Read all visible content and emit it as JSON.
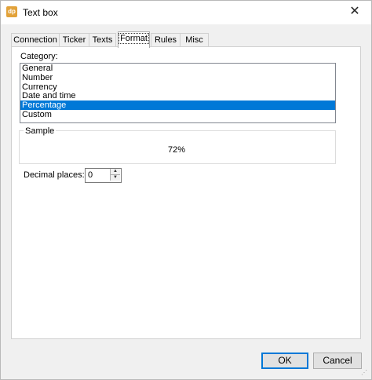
{
  "window": {
    "title": "Text box",
    "app_icon_text": "dp"
  },
  "tabs": [
    {
      "label": "Connection"
    },
    {
      "label": "Ticker"
    },
    {
      "label": "Texts"
    },
    {
      "label": "Format",
      "active": true
    },
    {
      "label": "Rules"
    },
    {
      "label": "Misc"
    }
  ],
  "category": {
    "label": "Category:",
    "items": [
      "General",
      "Number",
      "Currency",
      "Date and time",
      "Percentage",
      "Custom"
    ],
    "selected": "Percentage"
  },
  "sample": {
    "label": "Sample",
    "value": "72%"
  },
  "decimal_places": {
    "label": "Decimal places:",
    "value": "0"
  },
  "buttons": {
    "ok": "OK",
    "cancel": "Cancel"
  },
  "colors": {
    "selection": "#0078d7",
    "app_icon": "#e2a23a"
  }
}
